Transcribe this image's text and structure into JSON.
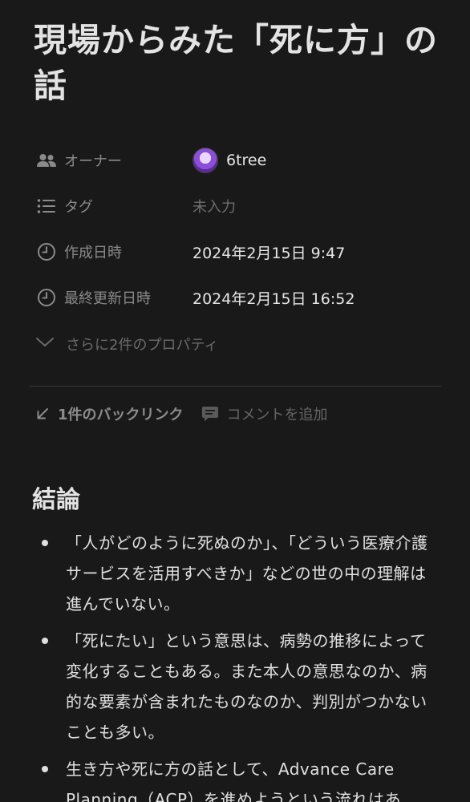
{
  "page": {
    "title": "現場からみた「死に方」の話"
  },
  "properties": [
    {
      "icon": "people-icon",
      "name": "オーナー",
      "value": "6tree",
      "type": "person"
    },
    {
      "icon": "list-icon",
      "name": "タグ",
      "value": "未入力",
      "type": "empty"
    },
    {
      "icon": "clock-icon",
      "name": "作成日時",
      "value": "2024年2月15日 9:47",
      "type": "text"
    },
    {
      "icon": "clock-icon",
      "name": "最終更新日時",
      "value": "2024年2月15日 16:52",
      "type": "text"
    }
  ],
  "more_properties": "さらに2件のプロパティ",
  "meta": {
    "backlinks": "1件のバックリンク",
    "add_comment": "コメントを追加"
  },
  "content": {
    "heading": "結論",
    "bullets": [
      "「人がどのように死ぬのか」、「どういう医療介護サービスを活用すべきか」などの世の中の理解は進んでいない。",
      "「死にたい」という意思は、病勢の推移によって変化することもある。また本人の意思なのか、病的な要素が含まれたものなのか、判別がつかないことも多い。",
      "生き方や死に方の話として、Advance Care Planning（ACP）を進めようという流れはあ"
    ]
  }
}
